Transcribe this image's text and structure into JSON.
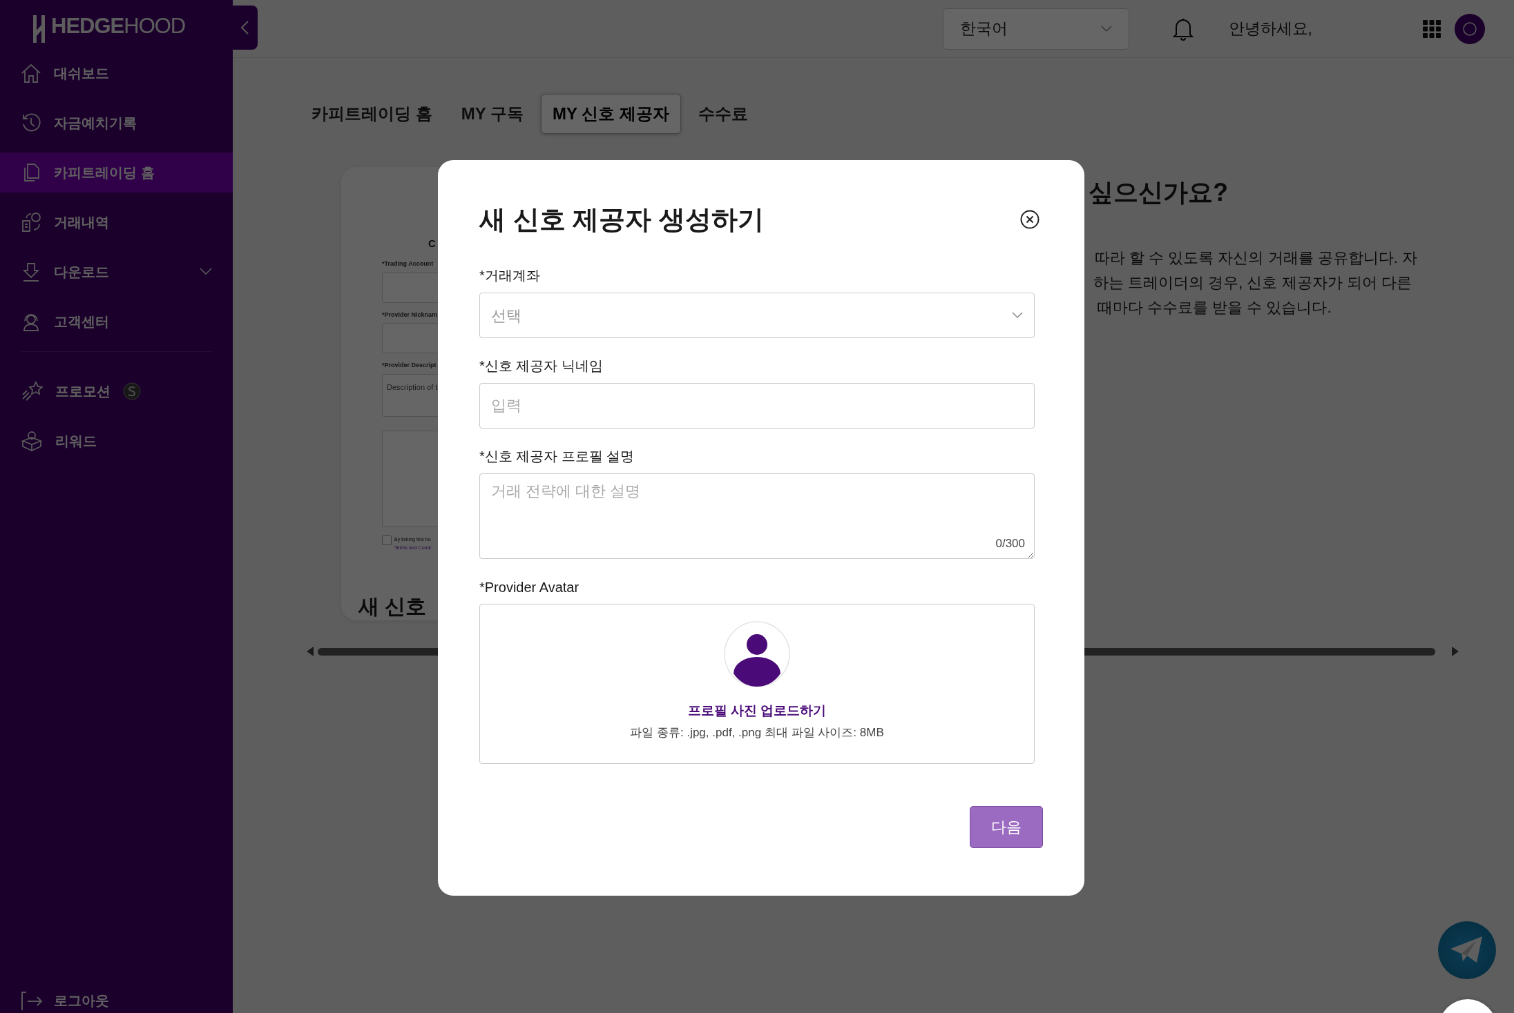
{
  "sidebar": {
    "logo": "**HEDGE**HOOD",
    "groups": [
      [
        {
          "label": "대쉬보드",
          "selected": false
        },
        {
          "label": "자금예치기록",
          "selected": false
        },
        {
          "label": "카피트레이딩 홈",
          "selected": true
        },
        {
          "label": "거래내역",
          "selected": false
        },
        {
          "label": "다운로드",
          "selected": false,
          "expanded": false
        },
        {
          "label": "고객센터",
          "selected": false
        }
      ],
      [
        {
          "label": "프로모션",
          "selected": false,
          "kind": "coin"
        },
        {
          "label": "리워드",
          "selected": false
        }
      ]
    ],
    "logout": "로그아웃"
  },
  "header": {
    "language": "한국어",
    "greeting": "안녕하세요,"
  },
  "tabs": [
    {
      "label": "카피트레이딩 홈",
      "selected": false
    },
    {
      "label": "MY 구독",
      "selected": false
    },
    {
      "label": "MY 신호 제공자",
      "selected": true
    },
    {
      "label": "수수료",
      "selected": false
    }
  ],
  "background": {
    "card": {
      "heading": "C",
      "labels": [
        "*Trading Account",
        "*Provider Nicknam",
        "*Provider Descript"
      ],
      "description_placeholder": "Description of t",
      "consent": "By ticking this bo",
      "consent_checked": false,
      "terms_link": "Terms and Condi",
      "title": "새 신호"
    },
    "heading": "싶으신가요?",
    "paragraph_lines": [
      "따라 할 수 있도록 자신의 거래를 공유합니다. 자",
      "하는 트레이더의 경우, 신호 제공자가 되어 다른",
      "때마다 수수료를 받을 수 있습니다."
    ]
  },
  "modal": {
    "title": "새 신호 제공자 생성하기",
    "fields": [
      {
        "kind": "select",
        "label": "*거래계좌",
        "placeholder": "선택"
      },
      {
        "kind": "input",
        "label": "*신호 제공자 닉네임",
        "placeholder": "입력"
      },
      {
        "kind": "textarea",
        "label": "*신호 제공자 프로필 설명",
        "placeholder": "거래 전략에 대한 설명",
        "counter": "0/300"
      }
    ],
    "avatar": {
      "label": "*Provider Avatar",
      "upload_text": "프로필 사진 업로드하기",
      "hint": "파일 종류: .jpg, .pdf, .png 최대 파일 사이즈: 8MB"
    },
    "next_button": {
      "label": "다음",
      "disabled": true
    }
  }
}
